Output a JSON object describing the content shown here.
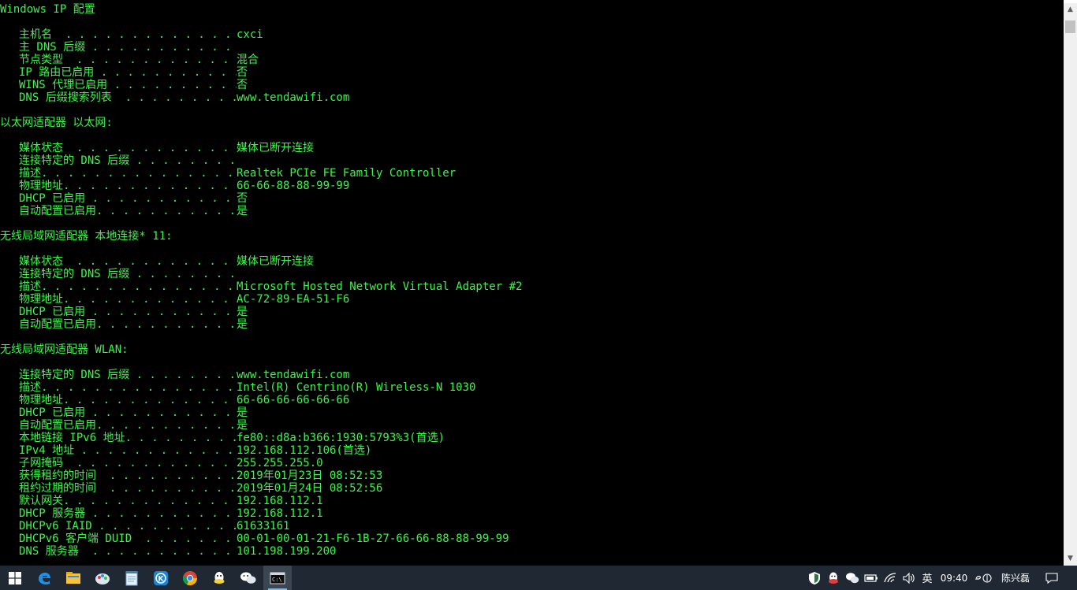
{
  "console": {
    "lines": [
      {
        "kind": "section",
        "text": "Windows IP 配置"
      },
      {
        "kind": "row",
        "key": "主机名  . . . . . . . . . . . . . . :",
        "value": "cxci"
      },
      {
        "kind": "row",
        "key": "主 DNS 后缀 . . . . . . . . . . . . :",
        "value": ""
      },
      {
        "kind": "row",
        "key": "节点类型  . . . . . . . . . . . . . :",
        "value": "混合"
      },
      {
        "kind": "row",
        "key": "IP 路由已启用 . . . . . . . . . . . :",
        "value": "否"
      },
      {
        "kind": "row",
        "key": "WINS 代理已启用 . . . . . . . . . . :",
        "value": "否"
      },
      {
        "kind": "row",
        "key": "DNS 后缀搜索列表  . . . . . . . . . :",
        "value": "www.tendawifi.com"
      },
      {
        "kind": "section",
        "text": "以太网适配器 以太网:"
      },
      {
        "kind": "row",
        "key": "媒体状态  . . . . . . . . . . . . . :",
        "value": "媒体已断开连接"
      },
      {
        "kind": "row",
        "key": "连接特定的 DNS 后缀 . . . . . . . . :",
        "value": ""
      },
      {
        "kind": "row",
        "key": "描述. . . . . . . . . . . . . . . . :",
        "value": "Realtek PCIe FE Family Controller"
      },
      {
        "kind": "row",
        "key": "物理地址. . . . . . . . . . . . . . :",
        "value": "66-66-88-88-99-99"
      },
      {
        "kind": "row",
        "key": "DHCP 已启用 . . . . . . . . . . . . :",
        "value": "否"
      },
      {
        "kind": "row",
        "key": "自动配置已启用. . . . . . . . . . . :",
        "value": "是"
      },
      {
        "kind": "section",
        "text": "无线局域网适配器 本地连接* 11:"
      },
      {
        "kind": "row",
        "key": "媒体状态  . . . . . . . . . . . . . :",
        "value": "媒体已断开连接"
      },
      {
        "kind": "row",
        "key": "连接特定的 DNS 后缀 . . . . . . . . :",
        "value": ""
      },
      {
        "kind": "row",
        "key": "描述. . . . . . . . . . . . . . . . :",
        "value": "Microsoft Hosted Network Virtual Adapter #2"
      },
      {
        "kind": "row",
        "key": "物理地址. . . . . . . . . . . . . . :",
        "value": "AC-72-89-EA-51-F6"
      },
      {
        "kind": "row",
        "key": "DHCP 已启用 . . . . . . . . . . . . :",
        "value": "是"
      },
      {
        "kind": "row",
        "key": "自动配置已启用. . . . . . . . . . . :",
        "value": "是"
      },
      {
        "kind": "section",
        "text": "无线局域网适配器 WLAN:"
      },
      {
        "kind": "row",
        "key": "连接特定的 DNS 后缀 . . . . . . . . :",
        "value": "www.tendawifi.com"
      },
      {
        "kind": "row",
        "key": "描述. . . . . . . . . . . . . . . . :",
        "value": "Intel(R) Centrino(R) Wireless-N 1030"
      },
      {
        "kind": "row",
        "key": "物理地址. . . . . . . . . . . . . . :",
        "value": "66-66-66-66-66-66"
      },
      {
        "kind": "row",
        "key": "DHCP 已启用 . . . . . . . . . . . . :",
        "value": "是"
      },
      {
        "kind": "row",
        "key": "自动配置已启用. . . . . . . . . . . :",
        "value": "是"
      },
      {
        "kind": "row",
        "key": "本地链接 IPv6 地址. . . . . . . . . :",
        "value": "fe80::d8a:b366:1930:5793%3(首选)"
      },
      {
        "kind": "row",
        "key": "IPv4 地址 . . . . . . . . . . . . . :",
        "value": "192.168.112.106(首选)"
      },
      {
        "kind": "row",
        "key": "子网掩码  . . . . . . . . . . . . . :",
        "value": "255.255.255.0"
      },
      {
        "kind": "row",
        "key": "获得租约的时间  . . . . . . . . . . :",
        "value": "2019年01月23日 08:52:53"
      },
      {
        "kind": "row",
        "key": "租约过期的时间  . . . . . . . . . . :",
        "value": "2019年01月24日 08:52:56"
      },
      {
        "kind": "row",
        "key": "默认网关. . . . . . . . . . . . . . :",
        "value": "192.168.112.1"
      },
      {
        "kind": "row",
        "key": "DHCP 服务器 . . . . . . . . . . . . :",
        "value": "192.168.112.1"
      },
      {
        "kind": "row",
        "key": "DHCPv6 IAID . . . . . . . . . . . . :",
        "value": "61633161"
      },
      {
        "kind": "row",
        "key": "DHCPv6 客户端 DUID  . . . . . . . . :",
        "value": "00-01-00-01-21-F6-1B-27-66-66-88-88-99-99"
      },
      {
        "kind": "row",
        "key": "DNS 服务器  . . . . . . . . . . . . :",
        "value": "101.198.199.200"
      }
    ]
  },
  "scrollbar": {
    "up_arrow": "▲",
    "down_arrow": "▼"
  },
  "taskbar": {
    "apps": [
      {
        "name": "start-button",
        "icon": "windows-logo-icon"
      },
      {
        "name": "edge-button",
        "icon": "edge-icon"
      },
      {
        "name": "file-explorer-button",
        "icon": "folder-icon"
      },
      {
        "name": "paint-button",
        "icon": "paint-icon"
      },
      {
        "name": "notepad-button",
        "icon": "notepad-icon"
      },
      {
        "name": "kugou-button",
        "icon": "kugou-icon"
      },
      {
        "name": "chrome-button",
        "icon": "chrome-icon"
      },
      {
        "name": "qq-button",
        "icon": "qq-icon"
      },
      {
        "name": "wechat-button",
        "icon": "wechat-icon"
      },
      {
        "name": "cmd-button",
        "icon": "cmd-icon"
      }
    ],
    "tray": {
      "ime_lang": "英",
      "time": "09:40",
      "user": "陈兴磊"
    }
  },
  "colors": {
    "console_text": "#3df54a",
    "console_bg": "#000000",
    "taskbar_bg": "#1f2833"
  }
}
